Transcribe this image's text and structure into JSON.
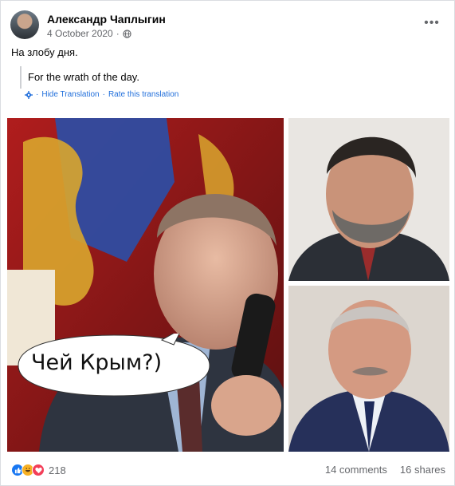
{
  "post": {
    "author": "Александр Чаплыгин",
    "date": "4 October 2020",
    "privacy_icon": "globe-icon",
    "more_label": "•••",
    "text": "На злобу дня.",
    "translation": {
      "text": "For the wrath of the day.",
      "separator": "·",
      "hide_label": "Hide Translation",
      "rate_label": "Rate this translation"
    },
    "media": {
      "bubble_text": "Чей Крым?)"
    },
    "reactions": {
      "icons": [
        "like-icon",
        "haha-icon",
        "love-icon"
      ],
      "count": "218"
    },
    "comments_label": "14 comments",
    "shares_label": "16 shares"
  },
  "colors": {
    "link": "#216fdb",
    "secondary_text": "#65676b",
    "like": "#1877f2",
    "haha": "#f7b125",
    "love": "#f33e58"
  }
}
